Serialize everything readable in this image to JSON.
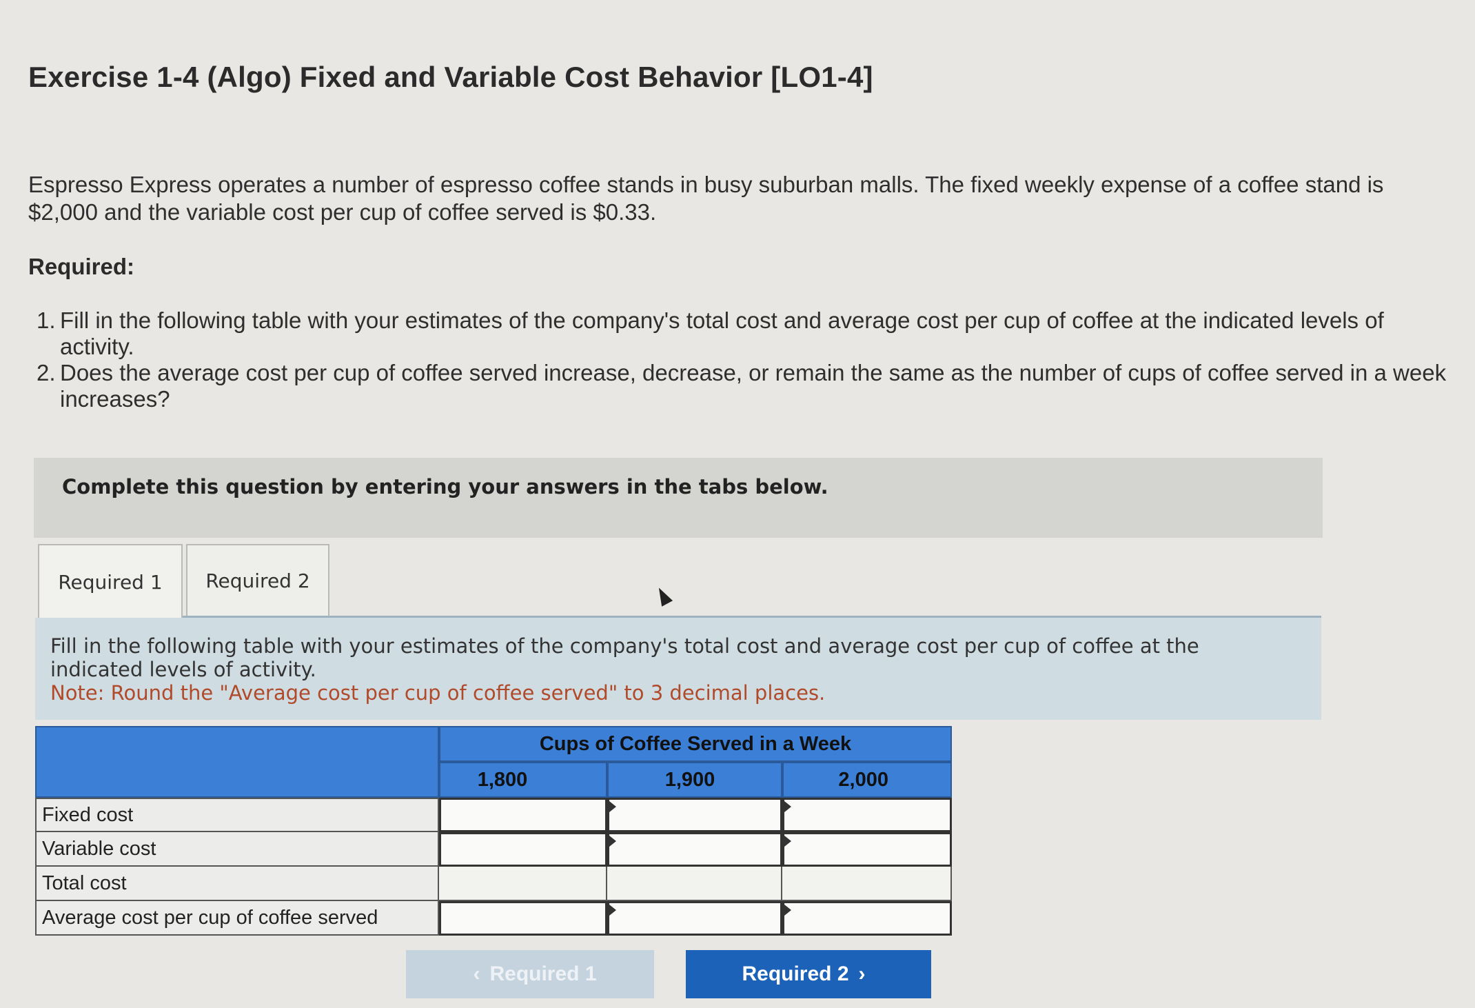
{
  "exercise": {
    "title": "Exercise 1-4 (Algo) Fixed and Variable Cost Behavior [LO1-4]",
    "intro": "Espresso Express operates a number of espresso coffee stands in busy suburban malls. The fixed weekly expense of a coffee stand is $2,000 and the variable cost per cup of coffee served is $0.33.",
    "required_heading": "Required:",
    "requirements": [
      {
        "num": "1.",
        "text": "Fill in the following table with your estimates of the company's total cost and average cost per cup of coffee at the indicated levels of activity."
      },
      {
        "num": "2.",
        "text": "Does the average cost per cup of coffee served increase, decrease, or remain the same as the number of cups of coffee served in a week increases?"
      }
    ]
  },
  "banner": "Complete this question by entering your answers in the tabs below.",
  "tabs": [
    {
      "label": "Required 1",
      "active": true
    },
    {
      "label": "Required 2",
      "active": false
    }
  ],
  "instructions": {
    "text": "Fill in the following table with your estimates of the company's total cost and average cost per cup of coffee at the indicated levels of activity.",
    "note": "Note: Round the \"Average cost per cup of coffee served\" to 3 decimal places."
  },
  "table": {
    "group_header": "Cups of Coffee Served in a Week",
    "columns": [
      "1,800",
      "1,900",
      "2,000"
    ],
    "rows": [
      {
        "label": "Fixed cost",
        "values": [
          "",
          "",
          ""
        ]
      },
      {
        "label": "Variable cost",
        "values": [
          "",
          "",
          ""
        ]
      },
      {
        "label": "Total cost",
        "values": [
          "",
          "",
          ""
        ]
      },
      {
        "label": "Average cost per cup of coffee served",
        "values": [
          "",
          "",
          ""
        ]
      }
    ]
  },
  "nav": {
    "prev_label": "Required 1",
    "next_label": "Required 2",
    "prev_icon": "chevron-left-icon",
    "next_icon": "chevron-right-icon"
  },
  "colors": {
    "header_blue": "#3b7fd6",
    "next_button": "#1b62b8",
    "note_text": "#b04a2a"
  }
}
